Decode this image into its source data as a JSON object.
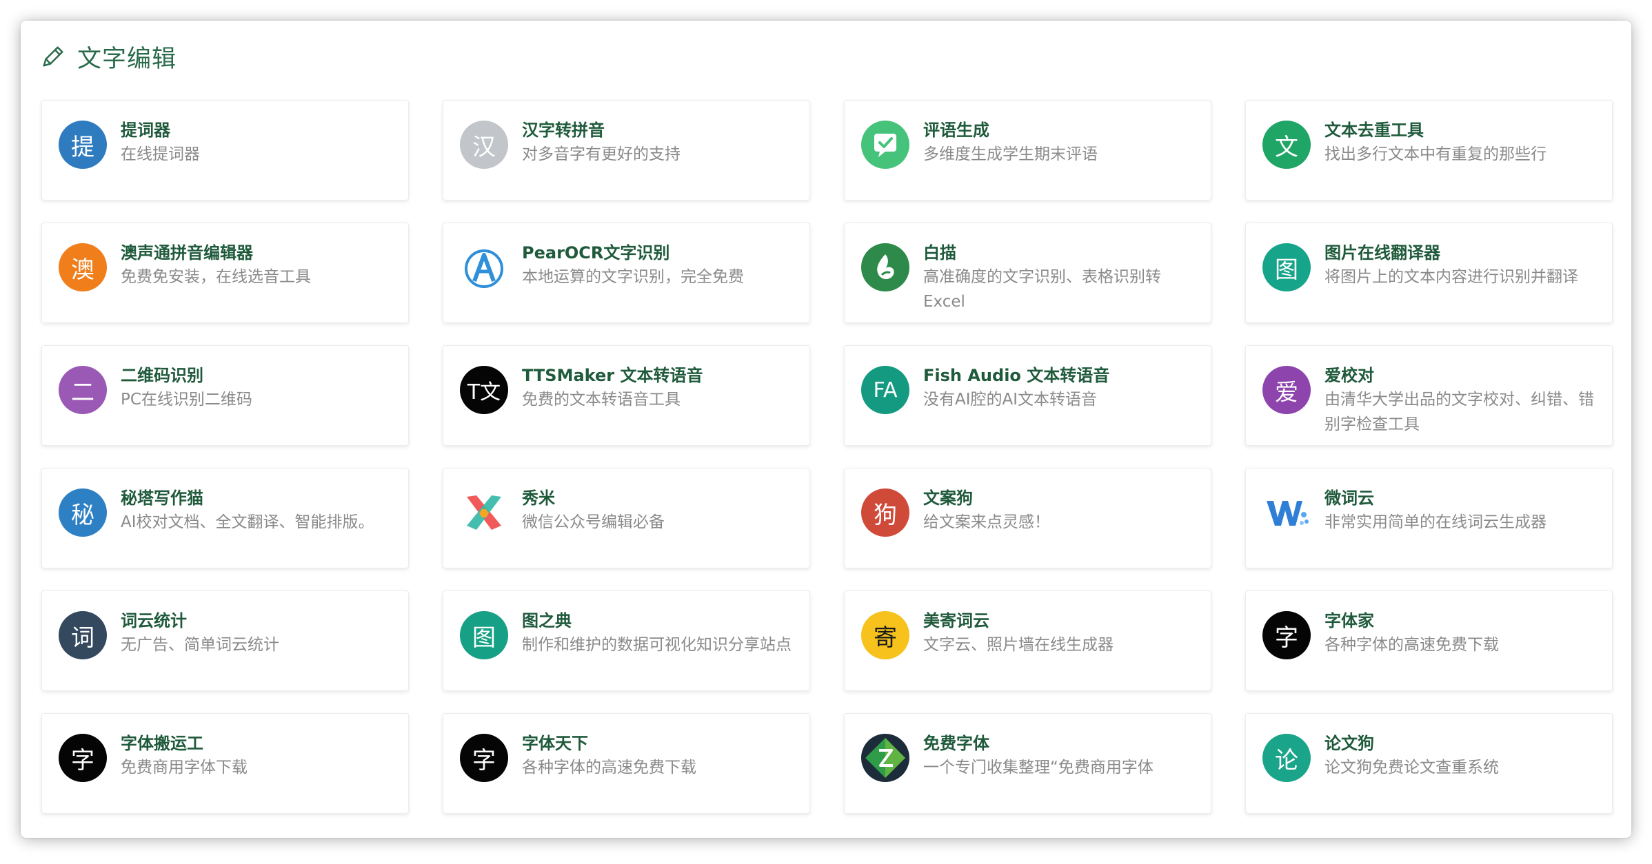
{
  "section": {
    "title": "文字编辑",
    "icon": "pencil-icon"
  },
  "tools": [
    {
      "name": "提词器",
      "desc": "在线提词器",
      "icon": "char",
      "glyph": "提",
      "color": "#2e7bbf"
    },
    {
      "name": "汉字转拼音",
      "desc": "对多音字有更好的支持",
      "icon": "char",
      "glyph": "汉",
      "color": "#c2c5c9"
    },
    {
      "name": "评语生成",
      "desc": "多维度生成学生期末评语",
      "icon": "chat-check",
      "color": "#46c37b"
    },
    {
      "name": "文本去重工具",
      "desc": "找出多行文本中有重复的那些行",
      "icon": "char",
      "glyph": "文",
      "color": "#1fa565"
    },
    {
      "name": "澳声通拼音编辑器",
      "desc": "免费免安装，在线选音工具",
      "icon": "char",
      "glyph": "澳",
      "color": "#f07f1b"
    },
    {
      "name": "PearOCR文字识别",
      "desc": "本地运算的文字识别，完全免费",
      "icon": "letter-a",
      "color": "#2f8fd8"
    },
    {
      "name": "白描",
      "desc": "高准确度的文字识别、表格识别转Excel",
      "icon": "leaf",
      "color": "#2e8a4a"
    },
    {
      "name": "图片在线翻译器",
      "desc": "将图片上的文本内容进行识别并翻译",
      "icon": "char",
      "glyph": "图",
      "color": "#16a48a"
    },
    {
      "name": "二维码识别",
      "desc": "PC在线识别二维码",
      "icon": "char",
      "glyph": "二",
      "color": "#9b59b6"
    },
    {
      "name": "TTSMaker 文本转语音",
      "desc": "免费的文本转语音工具",
      "icon": "char",
      "glyph": "T文",
      "color": "#050505"
    },
    {
      "name": "Fish Audio 文本转语音",
      "desc": "没有AI腔的AI文本转语音",
      "icon": "char",
      "glyph": "FA",
      "color": "#139a80"
    },
    {
      "name": "爱校对",
      "desc": "由清华大学出品的文字校对、纠错、错别字检查工具",
      "icon": "char",
      "glyph": "爱",
      "color": "#8e44ad"
    },
    {
      "name": "秘塔写作猫",
      "desc": "AI校对文档、全文翻译、智能排版。",
      "icon": "char",
      "glyph": "秘",
      "color": "#2e80c4"
    },
    {
      "name": "秀米",
      "desc": "微信公众号编辑必备",
      "icon": "pinwheel",
      "color": "#ffffff"
    },
    {
      "name": "文案狗",
      "desc": "给文案来点灵感！",
      "icon": "char",
      "glyph": "狗",
      "color": "#d04a3a"
    },
    {
      "name": "微词云",
      "desc": "非常实用简单的在线词云生成器",
      "icon": "w-logo",
      "color": "#2f7fd6"
    },
    {
      "name": "词云统计",
      "desc": "无广告、简单词云统计",
      "icon": "char",
      "glyph": "词",
      "color": "#34495e"
    },
    {
      "name": "图之典",
      "desc": "制作和维护的数据可视化知识分享站点",
      "icon": "char",
      "glyph": "图",
      "color": "#16a085"
    },
    {
      "name": "美寄词云",
      "desc": "文字云、照片墙在线生成器",
      "icon": "char",
      "glyph": "寄",
      "color": "#f6c21b"
    },
    {
      "name": "字体家",
      "desc": "各种字体的高速免费下载",
      "icon": "char",
      "glyph": "字",
      "color": "#050505"
    },
    {
      "name": "字体搬运工",
      "desc": "免费商用字体下载",
      "icon": "char",
      "glyph": "字",
      "color": "#050505"
    },
    {
      "name": "字体天下",
      "desc": "各种字体的高速免费下载",
      "icon": "char",
      "glyph": "字",
      "color": "#050505"
    },
    {
      "name": "免费字体",
      "desc": "一个专门收集整理“免费商用字体",
      "icon": "diamond-z",
      "color": "#1c2c3a"
    },
    {
      "name": "论文狗",
      "desc": "论文狗免费论文查重系统",
      "icon": "char",
      "glyph": "论",
      "color": "#1aa58a"
    }
  ]
}
